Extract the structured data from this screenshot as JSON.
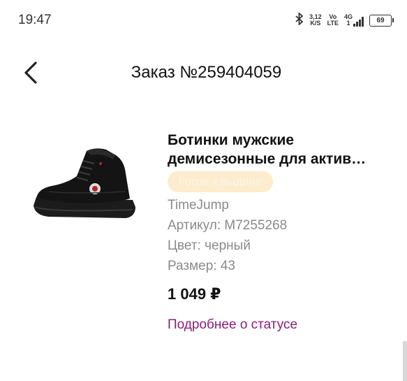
{
  "status_bar": {
    "time": "19:47",
    "net_speed": "3,12",
    "net_unit": "K/S",
    "volte_top": "Vo",
    "volte_bottom": "LTE",
    "network_type": "4G",
    "sim_slot": "1",
    "battery": "69"
  },
  "header": {
    "title": "Заказ №259404059"
  },
  "product": {
    "name_line1": "Ботинки мужские",
    "name_line2": "демисезонные для актив…",
    "status": "Готов к выдаче",
    "brand": "TimeJump",
    "article": "Артикул: M7255268",
    "color": "Цвет: черный",
    "size": "Размер: 43",
    "price": "1 049 ₽",
    "details_link": "Подробнее о статусе"
  },
  "colors": {
    "accent": "#8b1c7a",
    "badge_bg": "#fdeccd",
    "muted_text": "#8a8a8a"
  },
  "icons": [
    "bluetooth-icon",
    "signal-icon",
    "battery-icon",
    "back-arrow-icon",
    "sneaker-image"
  ]
}
